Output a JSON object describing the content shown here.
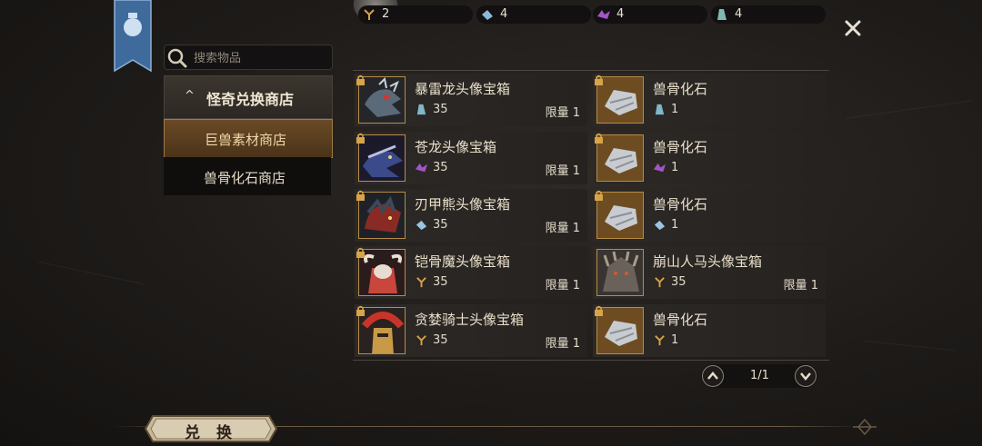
{
  "currencies": [
    {
      "icon": "gold-claw-icon",
      "value": "2"
    },
    {
      "icon": "blue-crystal-icon",
      "value": "4"
    },
    {
      "icon": "purple-dragon-icon",
      "value": "4"
    },
    {
      "icon": "teal-crystal-icon",
      "value": "4"
    }
  ],
  "search": {
    "placeholder": "搜索物品"
  },
  "nav": {
    "header": "怪奇兑换商店",
    "selected": "巨兽素材商店",
    "item": "兽骨化石商店"
  },
  "items": [
    {
      "name": "暴雷龙头像宝箱",
      "price": "35",
      "limit": "限量 1",
      "price_icon": "blue-crystal-icon",
      "thumb": "thunder-dragon-head"
    },
    {
      "name": "兽骨化石",
      "price": "1",
      "limit": "",
      "price_icon": "blue-crystal-icon",
      "thumb": "fossil-stone"
    },
    {
      "name": "苍龙头像宝箱",
      "price": "35",
      "limit": "限量 1",
      "price_icon": "purple-dragon-icon",
      "thumb": "azure-dragon-head"
    },
    {
      "name": "兽骨化石",
      "price": "1",
      "limit": "",
      "price_icon": "purple-dragon-icon",
      "thumb": "fossil-stone"
    },
    {
      "name": "刃甲熊头像宝箱",
      "price": "35",
      "limit": "限量 1",
      "price_icon": "ice-crystal-icon",
      "thumb": "blade-bear-head"
    },
    {
      "name": "兽骨化石",
      "price": "1",
      "limit": "",
      "price_icon": "ice-crystal-icon",
      "thumb": "fossil-stone"
    },
    {
      "name": "铠骨魔头像宝箱",
      "price": "35",
      "limit": "限量 1",
      "price_icon": "gold-claw-icon",
      "thumb": "bone-demon-head"
    },
    {
      "name": "崩山人马头像宝箱",
      "price": "35",
      "limit": "限量 1",
      "price_icon": "gold-claw-icon",
      "thumb": "centaur-head"
    },
    {
      "name": "贪婪骑士头像宝箱",
      "price": "35",
      "limit": "限量 1",
      "price_icon": "gold-claw-icon",
      "thumb": "greed-knight-head"
    },
    {
      "name": "兽骨化石",
      "price": "1",
      "limit": "",
      "price_icon": "gold-claw-icon",
      "thumb": "fossil-stone"
    }
  ],
  "pager": {
    "text": "1/1"
  },
  "exchange_button": "兑 换",
  "colors": {
    "accent": "#b68c46",
    "selected_tab": "#6a4a26"
  }
}
